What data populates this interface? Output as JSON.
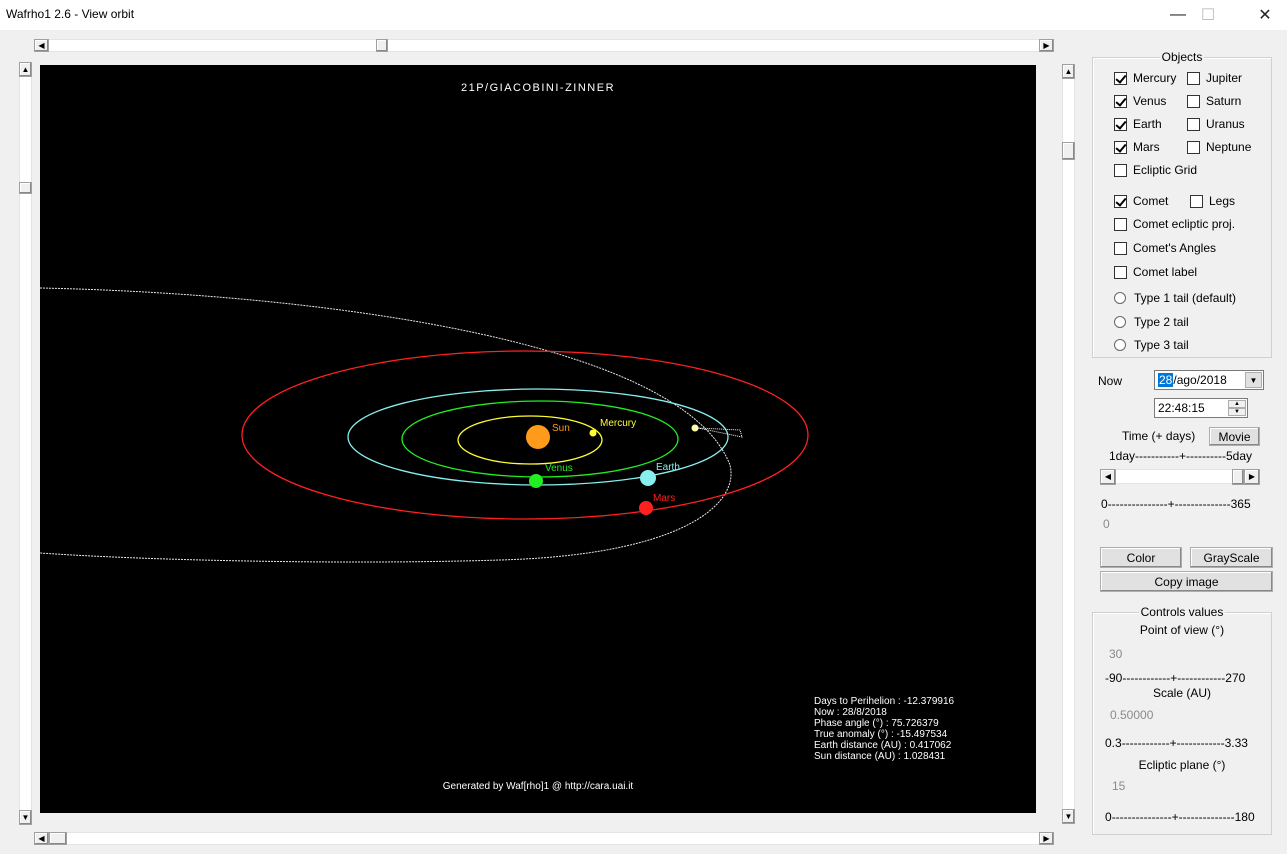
{
  "window": {
    "title": "Wafrho1 2.6 - View orbit",
    "minimize": "—",
    "maximize": "☐",
    "close": "✕"
  },
  "view": {
    "title": "21P/GIACOBINI-ZINNER",
    "footer": "Generated by Waf[rho]1 @ http://cara.uai.it",
    "info": [
      "Days to Perihelion : -12.379916",
      "Now : 28/8/2018",
      "Phase angle (°) : 75.726379",
      "True anomaly (°) : -15.497534",
      "Earth distance (AU) : 0.417062",
      "Sun distance (AU) : 1.028431"
    ],
    "bodies": {
      "sun": "Sun",
      "mercury": "Mercury",
      "venus": "Venus",
      "earth": "Earth",
      "mars": "Mars"
    },
    "colors": {
      "sun": "#ff9a1a",
      "mercury": "#ffff33",
      "venus": "#22ee22",
      "earth": "#88eeee",
      "mars": "#ff2020",
      "comet_orbit": "#e8e8e8"
    }
  },
  "objects": {
    "label": "Objects",
    "mercury": "Mercury",
    "jupiter": "Jupiter",
    "venus": "Venus",
    "saturn": "Saturn",
    "earth": "Earth",
    "uranus": "Uranus",
    "mars": "Mars",
    "neptune": "Neptune",
    "ecliptic_grid": "Ecliptic Grid",
    "comet": "Comet",
    "legs": "Legs",
    "comet_ecliptic_proj": "Comet ecliptic proj.",
    "comets_angles": "Comet's Angles",
    "comet_label": "Comet label",
    "type1": "Type 1 tail (default)",
    "type2": "Type 2 tail",
    "type3": "Type 3 tail"
  },
  "time": {
    "now_label": "Now",
    "date_day": "28",
    "date_rest": "/ago/2018",
    "time_value": "22:48:15",
    "time_days_label": "Time (+ days)",
    "movie": "Movie",
    "step_scale_min": "1day",
    "step_scale_max": "5day",
    "step_scale_line": "-----------+----------",
    "days_scale_min": "0",
    "days_scale_max": "365",
    "days_scale_line": "---------------+--------------",
    "days_value": "0"
  },
  "buttons": {
    "color": "Color",
    "grayscale": "GrayScale",
    "copy_image": "Copy image"
  },
  "controls": {
    "label": "Controls values",
    "pov_label": "Point of view (°)",
    "pov_value": "30",
    "pov_min": "-90",
    "pov_max": "270",
    "pov_line": "------------+------------",
    "scale_label": "Scale (AU)",
    "scale_value": "0.50000",
    "scale_min": "0.3",
    "scale_max": "3.33",
    "scale_line": "------------+------------",
    "ecl_label": "Ecliptic plane (°)",
    "ecl_value": "15",
    "ecl_min": "0",
    "ecl_max": "180",
    "ecl_line": "---------------+--------------"
  }
}
